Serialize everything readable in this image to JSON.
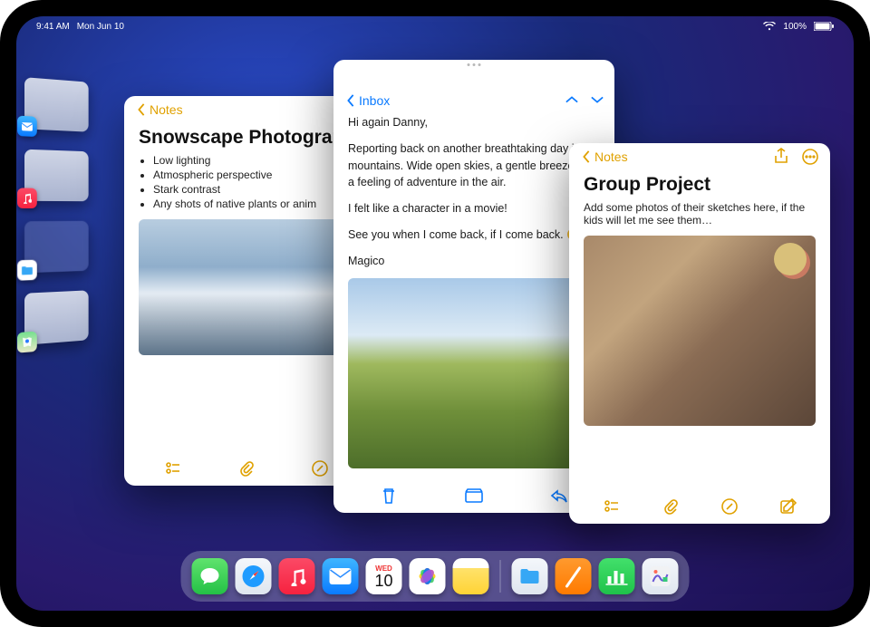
{
  "status": {
    "time": "9:41 AM",
    "date": "Mon Jun 10",
    "battery": "100%"
  },
  "stage_manager": {
    "items": [
      {
        "app_icon": "mail-icon"
      },
      {
        "app_icon": "music-icon"
      },
      {
        "app_icon": "files-icon"
      },
      {
        "app_icon": "maps-icon"
      }
    ]
  },
  "windows": {
    "notes_snowscape": {
      "app": "Notes",
      "back_label": "Notes",
      "title": "Snowscape Photograp",
      "bullets": [
        "Low lighting",
        "Atmospheric perspective",
        "Stark contrast",
        "Any shots of native plants or anim"
      ]
    },
    "mail": {
      "app": "Mail",
      "back_label": "Inbox",
      "greeting": "Hi again Danny,",
      "para1": "Reporting back on another breathtaking day in the mountains. Wide open skies, a gentle breeze, and a feeling of adventure in the air.",
      "para2": "I felt like a character in a movie!",
      "para3": "See you when I come back, if I come back. 😜",
      "signoff": "Magico"
    },
    "notes_group": {
      "app": "Notes",
      "back_label": "Notes",
      "title": "Group Project",
      "body": "Add some photos of their sketches here, if the kids will let me see them…"
    }
  },
  "dock": {
    "calendar": {
      "weekday": "WED",
      "day": "10"
    },
    "apps": [
      "messages",
      "safari",
      "music",
      "mail",
      "calendar",
      "photos",
      "notes",
      "files",
      "pages",
      "numbers",
      "freeform"
    ]
  }
}
